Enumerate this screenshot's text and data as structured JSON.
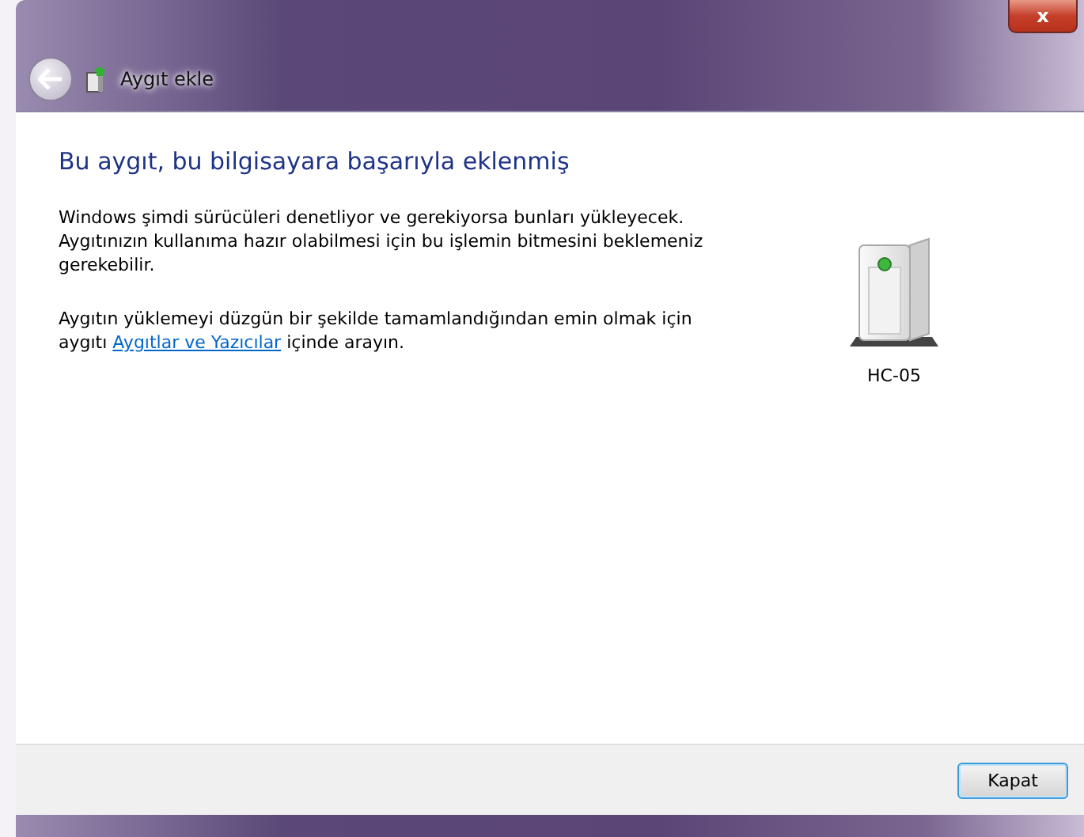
{
  "window": {
    "title": "Aygıt ekle",
    "close_label": "x"
  },
  "heading": "Bu aygıt, bu bilgisayara başarıyla eklenmiş",
  "paragraphs": [
    {
      "before": "Windows şimdi sürücüleri denetliyor ve gerekiyorsa bunları yükleyecek. Aygıtınızın kullanıma hazır olabilmesi için bu işlemin bitmesini beklemeniz gerekebilir."
    },
    {
      "before": "Aygıtın yüklemeyi düzgün bir şekilde tamamlandığından emin olmak için aygıtı ",
      "link": "Aygıtlar ve Yazıcılar",
      "after": " içinde arayın."
    }
  ],
  "device": {
    "name": "HC-05"
  },
  "buttons": [
    "Kapat"
  ]
}
